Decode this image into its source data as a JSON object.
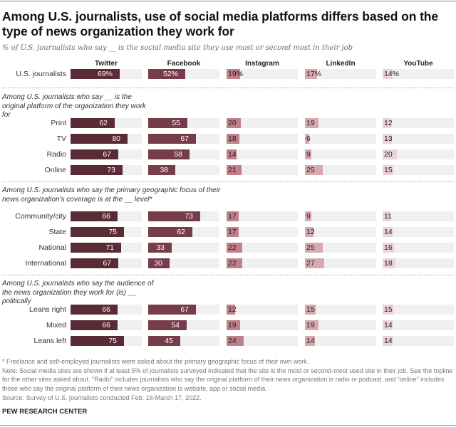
{
  "header": {
    "title": "Among U.S. journalists, use of social media platforms differs based on the type of news organization they work for",
    "subtitle": "% of U.S. journalists who say __ is the social media site they use most or second most in their job"
  },
  "chart_data": {
    "type": "bar",
    "orientation": "horizontal",
    "title": "Among U.S. journalists, use of social media platforms differs based on the type of news organization they work for",
    "subtitle": "% of U.S. journalists who say __ is the social media site they use most or second most in their job",
    "xlim": [
      0,
      100
    ],
    "grid": false,
    "platforms": [
      {
        "name": "Twitter",
        "color": "#5a2a35",
        "label_color": "#ffffff"
      },
      {
        "name": "Facebook",
        "color": "#763c4a",
        "label_color": "#ffffff"
      },
      {
        "name": "Instagram",
        "color": "#c0808a",
        "label_color": "#222222"
      },
      {
        "name": "LinkedIn",
        "color": "#d6a8b0",
        "label_color": "#222222"
      },
      {
        "name": "YouTube",
        "color": "#ecd3d8",
        "label_color": "#222222"
      }
    ],
    "sections": [
      {
        "heading": "",
        "rows": [
          {
            "label": "U.S. journalists",
            "values": [
              69,
              52,
              19,
              17,
              14
            ],
            "percent_sign": true
          }
        ]
      },
      {
        "heading": "Among U.S. journalists who say __ is the original platform of the organization they work for",
        "rows": [
          {
            "label": "Print",
            "values": [
              62,
              55,
              20,
              19,
              12
            ]
          },
          {
            "label": "TV",
            "values": [
              80,
              67,
              18,
              6,
              13
            ]
          },
          {
            "label": "Radio",
            "values": [
              67,
              58,
              14,
              9,
              20
            ]
          },
          {
            "label": "Online",
            "values": [
              73,
              38,
              21,
              25,
              15
            ]
          }
        ]
      },
      {
        "heading": "Among U.S. journalists who say the primary geographic focus of their news organization's coverage is at the __ level*",
        "rows": [
          {
            "label": "Community/city",
            "values": [
              66,
              73,
              17,
              9,
              11
            ]
          },
          {
            "label": "State",
            "values": [
              75,
              62,
              17,
              12,
              14
            ]
          },
          {
            "label": "National",
            "values": [
              71,
              33,
              22,
              25,
              16
            ]
          },
          {
            "label": "International",
            "values": [
              67,
              30,
              22,
              27,
              18
            ]
          }
        ]
      },
      {
        "heading": "Among U.S. journalists who say the audience of the news organization they work for (is) __ politically",
        "rows": [
          {
            "label": "Leans right",
            "values": [
              66,
              67,
              12,
              15,
              15
            ]
          },
          {
            "label": "Mixed",
            "values": [
              66,
              54,
              19,
              19,
              14
            ]
          },
          {
            "label": "Leans left",
            "values": [
              75,
              45,
              24,
              14,
              14
            ]
          }
        ]
      }
    ]
  },
  "footer": {
    "footnote": "* Freelance and self-employed journalists were asked about the primary geographic focus of their own work.",
    "note": "Note: Social media sites are shown if at least 5% of journalists surveyed indicated that the site is the most or second-most used site in their job. See the topline for the other sites asked about. “Radio” includes journalists who say the original platform of their news organization is radio or podcast, and “online” includes those who say the original platform of their news organization is website, app or social media.",
    "source": "Source: Survey of U.S. journalists conducted Feb. 16-March 17, 2022.",
    "brand": "PEW RESEARCH CENTER"
  }
}
